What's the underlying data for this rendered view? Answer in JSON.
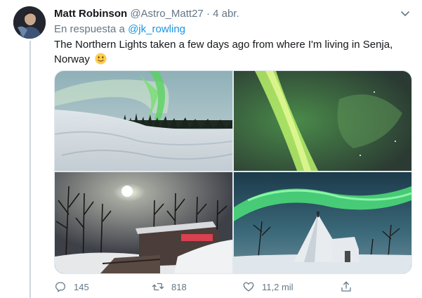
{
  "tweet": {
    "author_name": "Matt Robinson",
    "author_handle": "@Astro_Matt27",
    "separator": "·",
    "date": "4 abr.",
    "reply_prefix": "En respuesta a",
    "reply_to": "@jk_rowling",
    "text": "The Northern Lights taken a few days ago from where I'm living in Senja, Norway",
    "emoji": "slightly-smiling-face-emoji",
    "photos": [
      {
        "subject": "aurora-over-snowy-hill"
      },
      {
        "subject": "aurora-closeup"
      },
      {
        "subject": "cabin-trees-moon"
      },
      {
        "subject": "aurora-over-lavvu-tent"
      }
    ]
  },
  "actions": {
    "reply_count": "145",
    "retweet_count": "818",
    "like_count": "11,2 mil",
    "reply_icon": "reply-icon",
    "retweet_icon": "retweet-icon",
    "like_icon": "heart-icon",
    "share_icon": "share-icon"
  },
  "colors": {
    "text": "#14171a",
    "secondary": "#657786",
    "link": "#1b95e0",
    "border": "#e1e8ed",
    "aurora": "#5eea7a"
  }
}
